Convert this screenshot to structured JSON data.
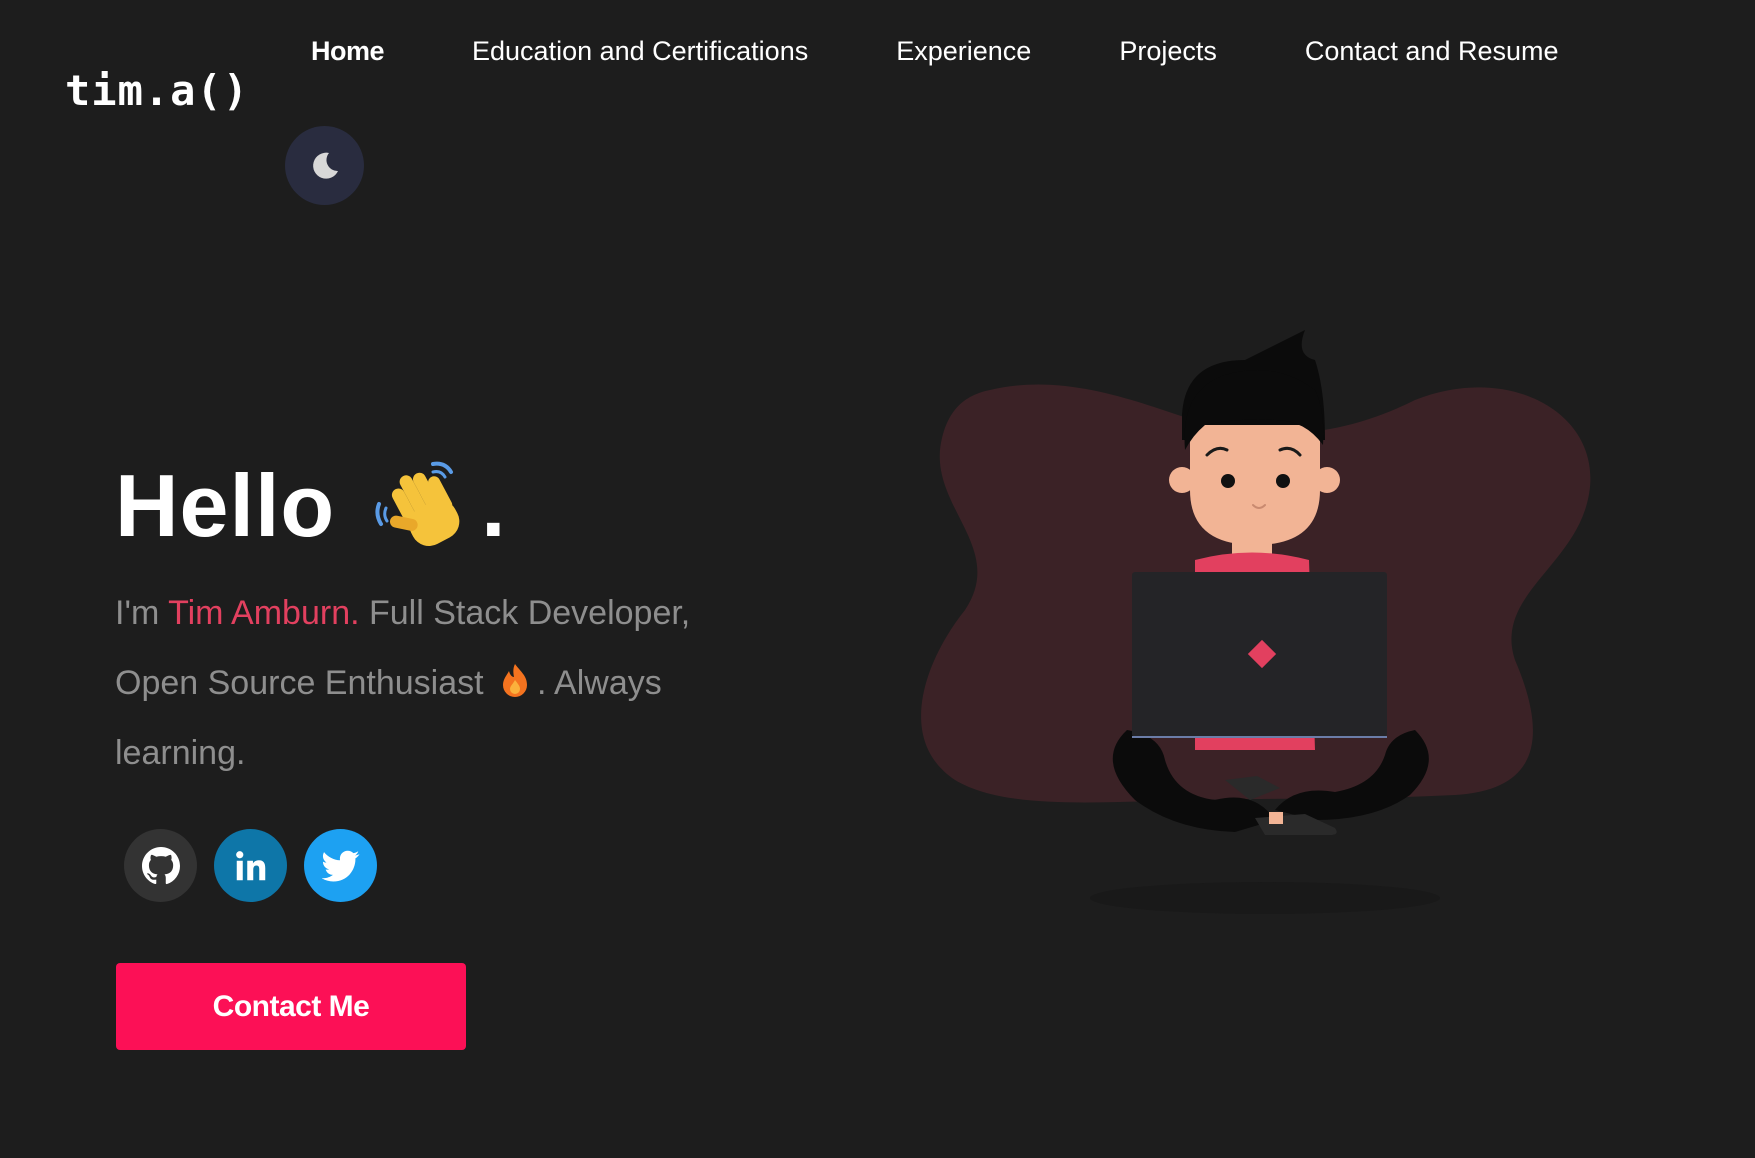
{
  "header": {
    "logo": "tim.a()",
    "nav": [
      {
        "label": "Home",
        "active": true
      },
      {
        "label": "Education and Certifications",
        "active": false
      },
      {
        "label": "Experience",
        "active": false
      },
      {
        "label": "Projects",
        "active": false
      },
      {
        "label": "Contact and Resume",
        "active": false
      }
    ],
    "theme_toggle_icon": "moon-icon"
  },
  "hero": {
    "greeting": "Hello",
    "greeting_emoji": "waving-hand-icon",
    "greeting_end": ".",
    "intro_prefix": "I'm ",
    "name": "Tim Amburn.",
    "intro_rest": " Full Stack Developer, Open Source Enthusiast",
    "fire_emoji": "fire-icon",
    "intro_end": ". Always learning.",
    "socials": [
      {
        "name": "GitHub",
        "icon": "github-icon",
        "color": "#333333"
      },
      {
        "name": "LinkedIn",
        "icon": "linkedin-icon",
        "color": "#0e76a8"
      },
      {
        "name": "Twitter",
        "icon": "twitter-icon",
        "color": "#1da1f2"
      }
    ],
    "cta_label": "Contact Me"
  },
  "colors": {
    "background": "#1d1d1d",
    "accent": "#fc1056",
    "name_highlight": "#e2405f",
    "blob": "#3b2226"
  }
}
